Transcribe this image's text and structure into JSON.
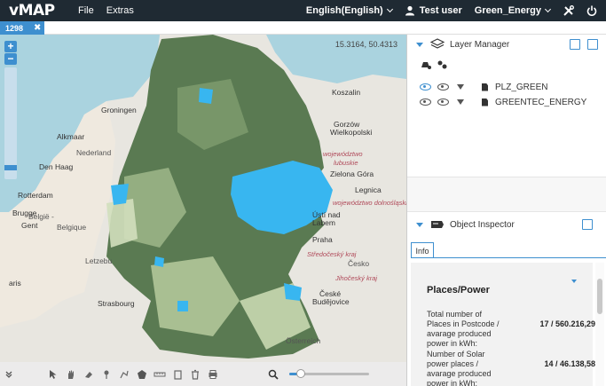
{
  "app": {
    "logo": "vMAP"
  },
  "topbar": {
    "menu": [
      "File",
      "Extras"
    ],
    "language": "English(English)",
    "user": "Test user",
    "project": "Green_Energy"
  },
  "tab": {
    "label": "1298",
    "close": "✖"
  },
  "map": {
    "coordinates": "15.3164, 50.4313",
    "labels": {
      "groningen": "Groningen",
      "alkmaar": "Alkmaar",
      "den_haag": "Den Haag",
      "nederland": "Nederland",
      "rotterdam": "Rotterdam",
      "brugge": "Brugge",
      "belgie": "België -",
      "belgique": "Belgique",
      "gent": "Gent",
      "letzebuerg": "Letzebu",
      "strasbourg": "Strasbourg",
      "paris": "aris",
      "ustinad": "Ústí nad",
      "labem": "Labem",
      "praha": "Praha",
      "cesko": "Česko",
      "ceske": "České",
      "budejovice": "Budějovice",
      "koszalin": "Koszalin",
      "gorzow": "Gorzów",
      "wielkopolski": "Wielkopolski",
      "zielona": "Zielona Góra",
      "legnica": "Legnica",
      "wojewodztwo": "województwo",
      "lubuskie": "lubuskie",
      "dolnoslaskie": "województwo dolnośląskie",
      "sredoceskykraj": "Středočeský kraj",
      "jihocesky": "Jihočeský kraj",
      "ostereich": "Österreich"
    }
  },
  "zoom": {
    "in": "+",
    "out": "−"
  },
  "layer_manager": {
    "title": "Layer Manager",
    "layers": [
      {
        "name": "PLZ_GREEN"
      },
      {
        "name": "GREENTEC_ENERGY"
      }
    ]
  },
  "object_inspector": {
    "title": "Object Inspector",
    "tab": "Info",
    "section_title": "Places/Power",
    "rows": [
      {
        "label": "Total number of Places in Postcode / avarage produced power in kWh:",
        "value": "17 / 560.216,29"
      },
      {
        "label": "Number of Solar power places / avarage produced power in kWh:",
        "value": "14 / 46.138,58"
      }
    ]
  },
  "colors": {
    "accent": "#3e8fcf",
    "topbar": "#1f2a33",
    "map_dark_green": "#5a7a52",
    "map_light_green": "#c8d8b0",
    "map_blue": "#38b6f0"
  }
}
